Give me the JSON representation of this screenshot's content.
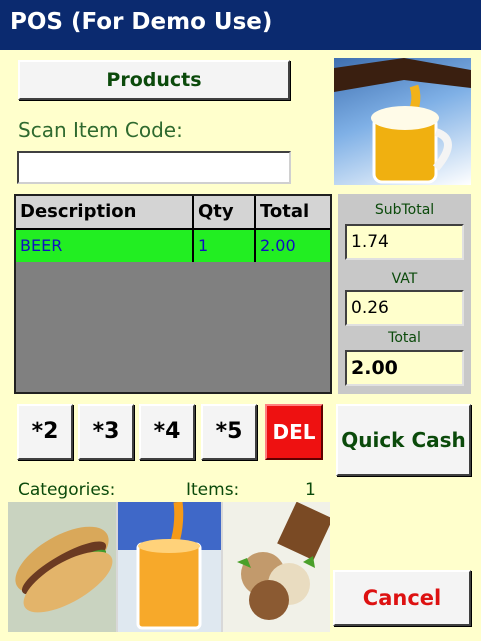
{
  "window": {
    "title": "POS (For Demo Use)"
  },
  "products_button": {
    "label": "Products"
  },
  "scan": {
    "label": "Scan Item Code:",
    "value": ""
  },
  "table": {
    "headers": [
      "Description",
      "Qty",
      "Total"
    ],
    "rows": [
      {
        "description": "BEER",
        "qty": "1",
        "total": "2.00"
      }
    ]
  },
  "totals": {
    "subtotal_label": "SubTotal",
    "subtotal_value": "1.74",
    "vat_label": "VAT",
    "vat_value": "0.26",
    "total_label": "Total",
    "total_value": "2.00"
  },
  "multipliers": [
    "*2",
    "*3",
    "*4",
    "*5"
  ],
  "del_label": "DEL",
  "quick_cash_label": "Quick Cash",
  "categories_label": "Categories:",
  "items_label": "Items:",
  "items_count": "1",
  "cancel_label": "Cancel",
  "colors": {
    "titlebar": "#0b2a6f",
    "background": "#ffffcc",
    "row_highlight": "#22ee22",
    "del": "#ee1111",
    "cancel_text": "#dd1111"
  }
}
